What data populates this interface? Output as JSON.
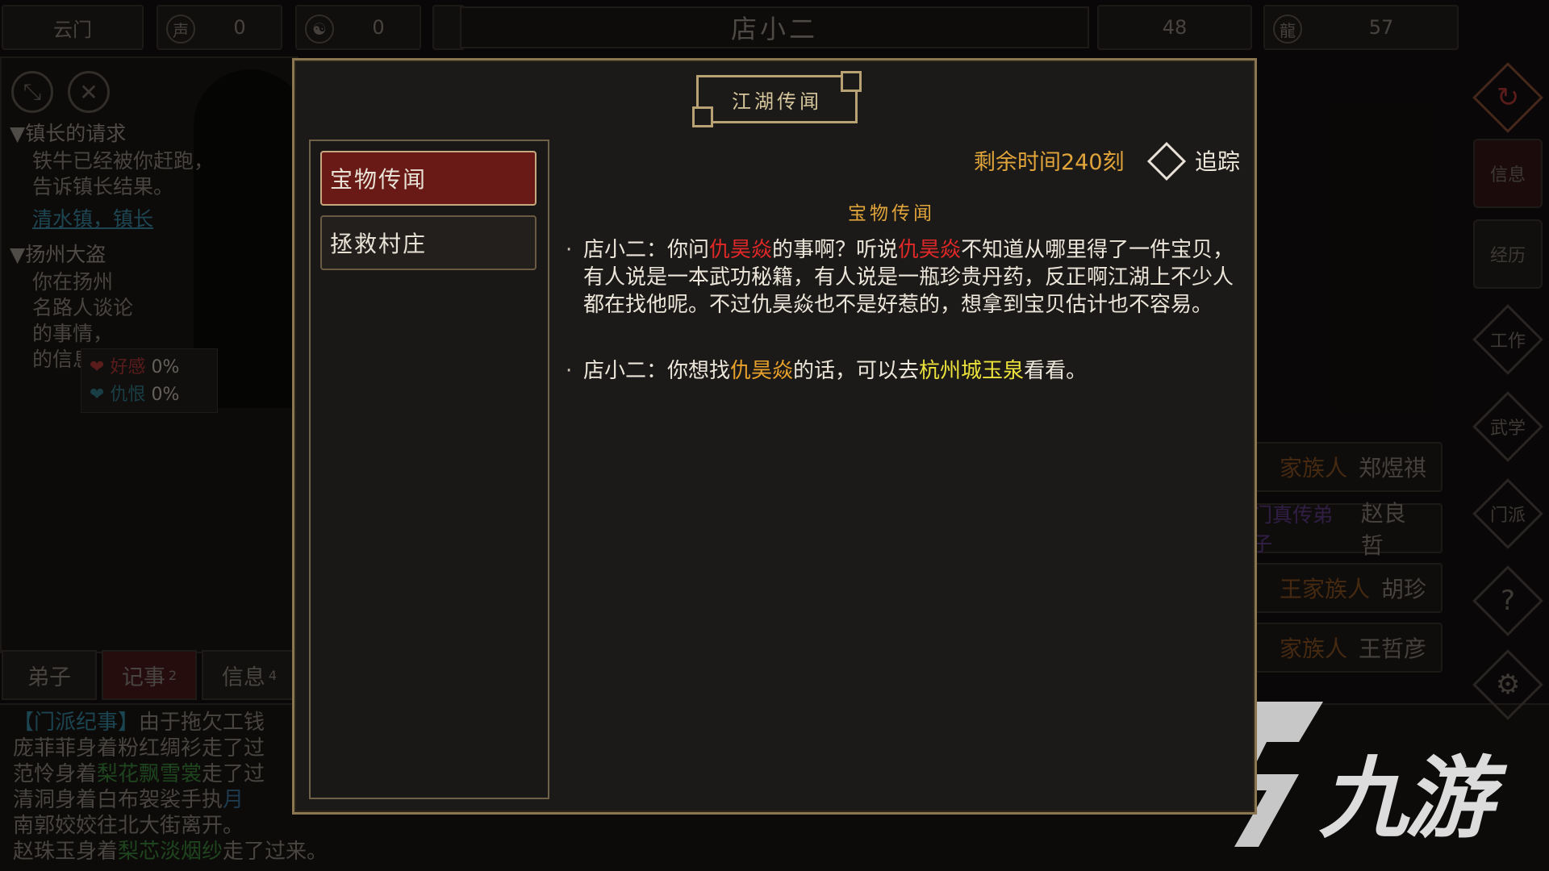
{
  "topbar": {
    "sect_name": "云门",
    "reputation_icon_label": "声望",
    "reputation": "0",
    "yin_yang": "0",
    "npc_name": "店小二",
    "stat_a": "48",
    "stat_b": "57"
  },
  "left_panel": {
    "quests": [
      {
        "title": "▼镇长的请求",
        "lines": [
          "铁牛已经被你赶跑，",
          "告诉镇长结果。"
        ],
        "link": "清水镇，镇长"
      },
      {
        "title": "▼扬州大盗",
        "lines": [
          "你在扬州",
          "名路人谈论",
          "的事情，",
          "的信息"
        ]
      }
    ],
    "favor": {
      "like_label": "好感",
      "like_value": "0%",
      "hate_label": "仇恨",
      "hate_value": "0%"
    }
  },
  "bottom_tabs": [
    {
      "label": "弟子",
      "badge": ""
    },
    {
      "label": "记事",
      "badge": "2"
    },
    {
      "label": "信息",
      "badge": "4"
    }
  ],
  "log": {
    "line1_tag": "【门派纪事】",
    "line1": "由于拖欠工钱",
    "line2": "庞菲菲身着粉红绸衫走了过",
    "line3_a": "范怜身着",
    "line3_item": "梨花飘雪裳",
    "line3_b": "走了过",
    "line4_a": "清洞身着白布袈裟手执",
    "line4_item": "月",
    "line5": "南郭姣姣往北大街离开。",
    "line6_a": "赵珠玉身着",
    "line6_item": "梨芯淡烟纱",
    "line6_b": "走了过来。"
  },
  "right_rail": {
    "info": "信息",
    "experience": "经历",
    "work": "工作",
    "martial": "武学",
    "sect": "门派",
    "help": "?",
    "settings": "⚙"
  },
  "npc_list": [
    {
      "family": "家族人",
      "name": "郑煜祺"
    },
    {
      "family": "门真传弟子",
      "name": "赵良哲"
    },
    {
      "family": "王家族人",
      "name": "胡珍"
    },
    {
      "family": "家族人",
      "name": "王哲彦"
    }
  ],
  "brand": {
    "text": "九游"
  },
  "modal": {
    "title": "江湖传闻",
    "tabs": [
      "宝物传闻",
      "拯救村庄"
    ],
    "timer": "剩余时间240刻",
    "track": "追踪",
    "section_title": "宝物传闻",
    "p1": {
      "speaker": "店小二：你问",
      "name1": "仇昊焱",
      "t1": "的事啊？听说",
      "name2": "仇昊焱",
      "t2": "不知道从哪里得了一件宝贝，有人说是一本武功秘籍，有人说是一瓶珍贵丹药，反正啊江湖上不少人都在找他呢。不过仇昊焱也不是好惹的，想拿到宝贝估计也不容易。"
    },
    "p2": {
      "speaker": "店小二：你想找",
      "name": "仇昊焱",
      "t1": "的话，可以去",
      "place": "杭州城玉泉",
      "t2": "看看。"
    }
  },
  "colors": {
    "gold_border": "#8a7650",
    "active_tab": "#6a1a16",
    "accent_orange": "#e8a12a",
    "accent_red": "#e02828",
    "accent_yellow": "#ece23c"
  }
}
